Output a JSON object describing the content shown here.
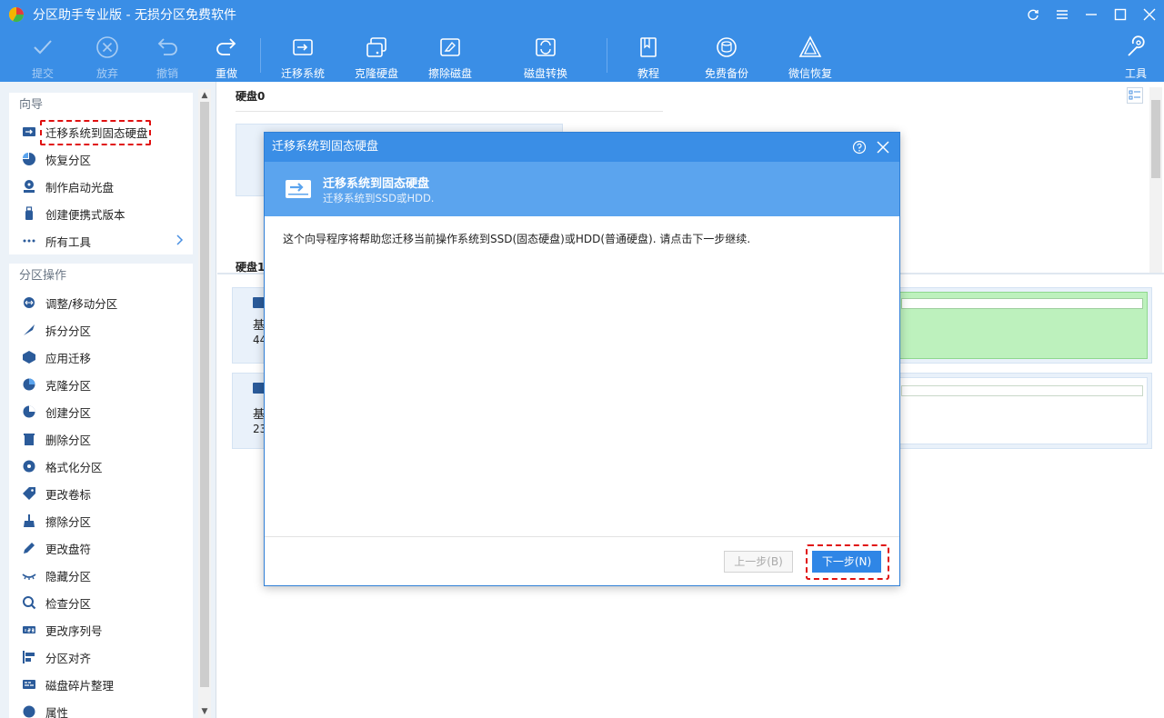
{
  "app": {
    "title": "分区助手专业版 - 无损分区免费软件",
    "brand_color": "#3a8ee6"
  },
  "toolbar": {
    "commit": "提交",
    "discard": "放弃",
    "undo": "撤销",
    "redo": "重做",
    "migrate_os": "迁移系统",
    "clone_disk": "克隆硬盘",
    "wipe_disk": "擦除磁盘",
    "disk_convert": "磁盘转换",
    "tutorial": "教程",
    "free_backup": "免费备份",
    "wechat_recovery": "微信恢复",
    "tools": "工具"
  },
  "sidebar": {
    "wizard_title": "向导",
    "wizard_items": [
      {
        "label": "迁移系统到固态硬盘",
        "icon": "migrate-icon"
      },
      {
        "label": "恢复分区",
        "icon": "pie-icon"
      },
      {
        "label": "制作启动光盘",
        "icon": "boot-disc-icon"
      },
      {
        "label": "创建便携式版本",
        "icon": "usb-icon"
      },
      {
        "label": "所有工具",
        "icon": "more-icon"
      }
    ],
    "ops_title": "分区操作",
    "ops_items": [
      {
        "label": "调整/移动分区",
        "icon": "resize-icon"
      },
      {
        "label": "拆分分区",
        "icon": "split-icon"
      },
      {
        "label": "应用迁移",
        "icon": "app-move-icon"
      },
      {
        "label": "克隆分区",
        "icon": "clone-icon"
      },
      {
        "label": "创建分区",
        "icon": "create-icon"
      },
      {
        "label": "删除分区",
        "icon": "delete-icon"
      },
      {
        "label": "格式化分区",
        "icon": "format-icon"
      },
      {
        "label": "更改卷标",
        "icon": "tag-icon"
      },
      {
        "label": "擦除分区",
        "icon": "wipe-icon"
      },
      {
        "label": "更改盘符",
        "icon": "pen-icon"
      },
      {
        "label": "隐藏分区",
        "icon": "hide-icon"
      },
      {
        "label": "检查分区",
        "icon": "check-icon"
      },
      {
        "label": "更改序列号",
        "icon": "serial-icon"
      },
      {
        "label": "分区对齐",
        "icon": "align-icon"
      },
      {
        "label": "磁盘碎片整理",
        "icon": "defrag-icon"
      },
      {
        "label": "属性",
        "icon": "info-icon"
      }
    ]
  },
  "main": {
    "disk0_label": "硬盘0",
    "disk1_label": "硬盘1",
    "row1_type": "基",
    "row1_size": "44",
    "row2_type": "基",
    "row2_size": "23"
  },
  "dialog": {
    "title": "迁移系统到固态硬盘",
    "header_title": "迁移系统到固态硬盘",
    "header_subtitle": "迁移系统到SSD或HDD.",
    "body": "这个向导程序将帮助您迁移当前操作系统到SSD(固态硬盘)或HDD(普通硬盘). 请点击下一步继续.",
    "prev_button": "上一步(B)",
    "next_button": "下一步(N)"
  }
}
